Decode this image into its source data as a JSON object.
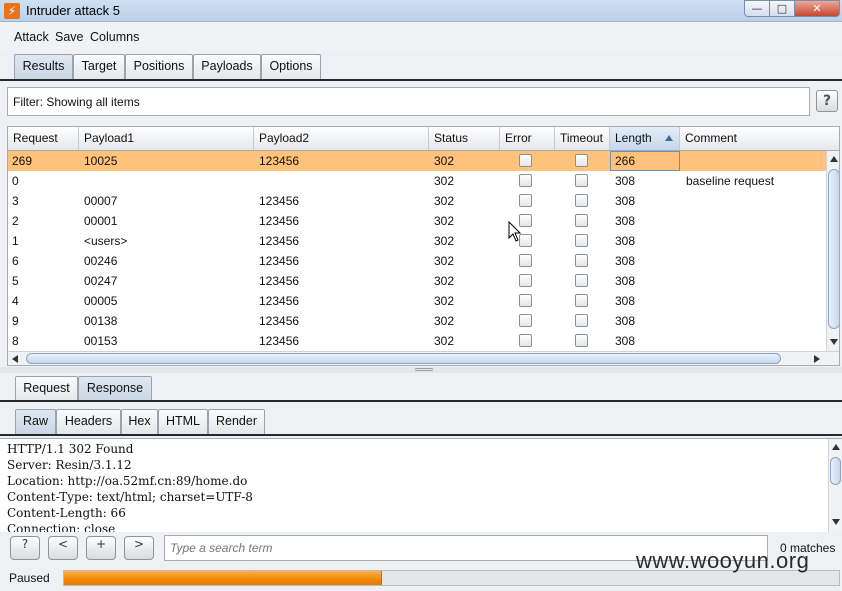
{
  "window": {
    "title": "Intruder attack 5",
    "min": "—",
    "max": "□",
    "close": "✕"
  },
  "menu": [
    "Attack",
    "Save",
    "Columns"
  ],
  "main_tabs": [
    {
      "label": "Results",
      "active": true
    },
    {
      "label": "Target",
      "active": false
    },
    {
      "label": "Positions",
      "active": false
    },
    {
      "label": "Payloads",
      "active": false
    },
    {
      "label": "Options",
      "active": false
    }
  ],
  "filter": {
    "text": "Filter: Showing all items",
    "help": "?"
  },
  "table": {
    "columns": [
      "Request",
      "Payload1",
      "Payload2",
      "Status",
      "Error",
      "Timeout",
      "Length",
      "Comment"
    ],
    "sorted_column": "Length",
    "selected_row_color": "#ffc27a",
    "rows": [
      {
        "request": "269",
        "payload1": "10025",
        "payload2": "123456",
        "status": "302",
        "error": false,
        "timeout": false,
        "length": "266",
        "comment": "",
        "selected": true
      },
      {
        "request": "0",
        "payload1": "",
        "payload2": "",
        "status": "302",
        "error": false,
        "timeout": false,
        "length": "308",
        "comment": "baseline request",
        "selected": false
      },
      {
        "request": "3",
        "payload1": "00007",
        "payload2": "123456",
        "status": "302",
        "error": false,
        "timeout": false,
        "length": "308",
        "comment": "",
        "selected": false
      },
      {
        "request": "2",
        "payload1": "00001",
        "payload2": "123456",
        "status": "302",
        "error": false,
        "timeout": false,
        "length": "308",
        "comment": "",
        "selected": false
      },
      {
        "request": "1",
        "payload1": "<users>",
        "payload2": "123456",
        "status": "302",
        "error": false,
        "timeout": false,
        "length": "308",
        "comment": "",
        "selected": false
      },
      {
        "request": "6",
        "payload1": "00246",
        "payload2": "123456",
        "status": "302",
        "error": false,
        "timeout": false,
        "length": "308",
        "comment": "",
        "selected": false
      },
      {
        "request": "5",
        "payload1": "00247",
        "payload2": "123456",
        "status": "302",
        "error": false,
        "timeout": false,
        "length": "308",
        "comment": "",
        "selected": false
      },
      {
        "request": "4",
        "payload1": "00005",
        "payload2": "123456",
        "status": "302",
        "error": false,
        "timeout": false,
        "length": "308",
        "comment": "",
        "selected": false
      },
      {
        "request": "9",
        "payload1": "00138",
        "payload2": "123456",
        "status": "302",
        "error": false,
        "timeout": false,
        "length": "308",
        "comment": "",
        "selected": false
      },
      {
        "request": "8",
        "payload1": "00153",
        "payload2": "123456",
        "status": "302",
        "error": false,
        "timeout": false,
        "length": "308",
        "comment": "",
        "selected": false
      }
    ]
  },
  "detail_tabs": [
    {
      "label": "Request",
      "active": false
    },
    {
      "label": "Response",
      "active": true
    }
  ],
  "view_tabs": [
    {
      "label": "Raw",
      "active": true
    },
    {
      "label": "Headers",
      "active": false
    },
    {
      "label": "Hex",
      "active": false
    },
    {
      "label": "HTML",
      "active": false
    },
    {
      "label": "Render",
      "active": false
    }
  ],
  "response_lines": [
    "HTTP/1.1 302 Found",
    "Server: Resin/3.1.12",
    "Location: http://oa.52mf.cn:89/home.do",
    "Content-Type: text/html; charset=UTF-8",
    "Content-Length: 66",
    "Connection: close"
  ],
  "search": {
    "help": "?",
    "prev": "<",
    "add": "+",
    "next": ">",
    "placeholder": "Type a search term",
    "matches": "0 matches"
  },
  "status": {
    "label": "Paused",
    "progress_fraction": 0.41,
    "progress_color": "#f28705"
  },
  "watermark": "www.wooyun.org"
}
